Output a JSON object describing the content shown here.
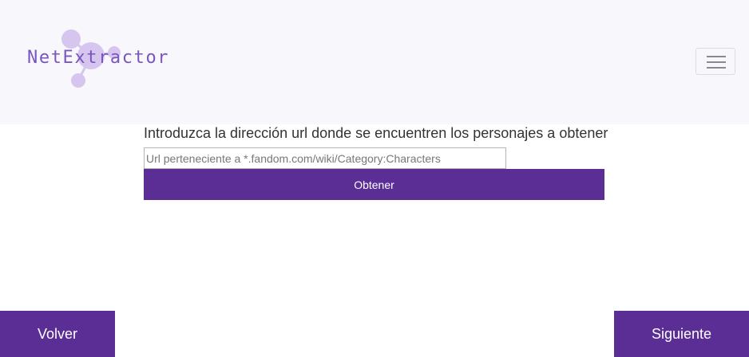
{
  "header": {
    "brand_name": "NetExtractor",
    "menu_toggle_icon": "hamburger-menu-icon",
    "brand_icon": "molecule-network-icon",
    "background_color": "#f8f8fc",
    "brand_color": "#7a55c0"
  },
  "form": {
    "prompt": "Introduzca la dirección url donde se encuentren los personajes a obtener",
    "url_placeholder": "Url perteneciente a *.fandom.com/wiki/Category:Characters",
    "url_value": "",
    "submit_label": "Obtener"
  },
  "footer": {
    "back_label": "Volver",
    "next_label": "Siguiente"
  },
  "colors": {
    "accent": "#5b2e96",
    "logo_circles": "#d6c6ef"
  }
}
